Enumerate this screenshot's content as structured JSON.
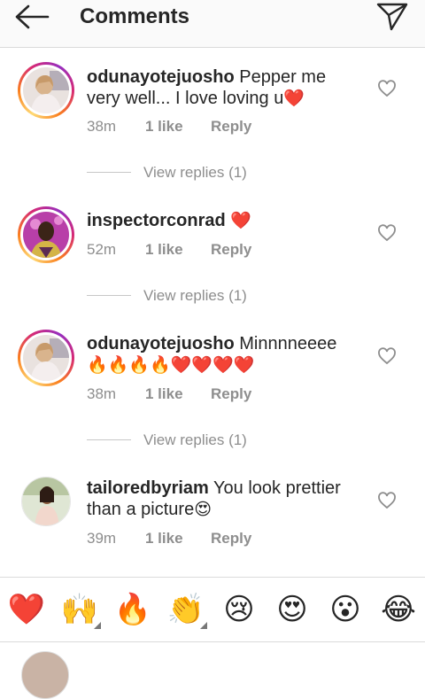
{
  "header": {
    "title": "Comments"
  },
  "comments": [
    {
      "username": "odunayotejuoshо",
      "text": "Pepper me very well... I love loving u",
      "emoji": "❤️",
      "time": "38m",
      "likes": "1 like",
      "reply": "Reply",
      "view_replies": "View replies (1)"
    },
    {
      "username": "inspectorconrad",
      "text": "",
      "emoji": "❤️",
      "time": "52m",
      "likes": "1 like",
      "reply": "Reply",
      "view_replies": "View replies (1)"
    },
    {
      "username": "odunayotejuosho",
      "text": "Minnnneeee",
      "emoji": "🔥🔥🔥🔥❤️❤️❤️❤️",
      "time": "38m",
      "likes": "1 like",
      "reply": "Reply",
      "view_replies": "View replies (1)"
    },
    {
      "username": "tailoredbyriam",
      "text": "You look prettier than a picture",
      "emoji": "😍",
      "time": "39m",
      "likes": "1 like",
      "reply": "Reply"
    }
  ],
  "emoji_bar": [
    "❤️",
    "🙌",
    "🔥",
    "👏",
    "😢",
    "😍",
    "😮",
    "😂"
  ],
  "colors": {
    "heart": "#e0162b",
    "muted": "#8e8e8e",
    "text": "#262626"
  }
}
